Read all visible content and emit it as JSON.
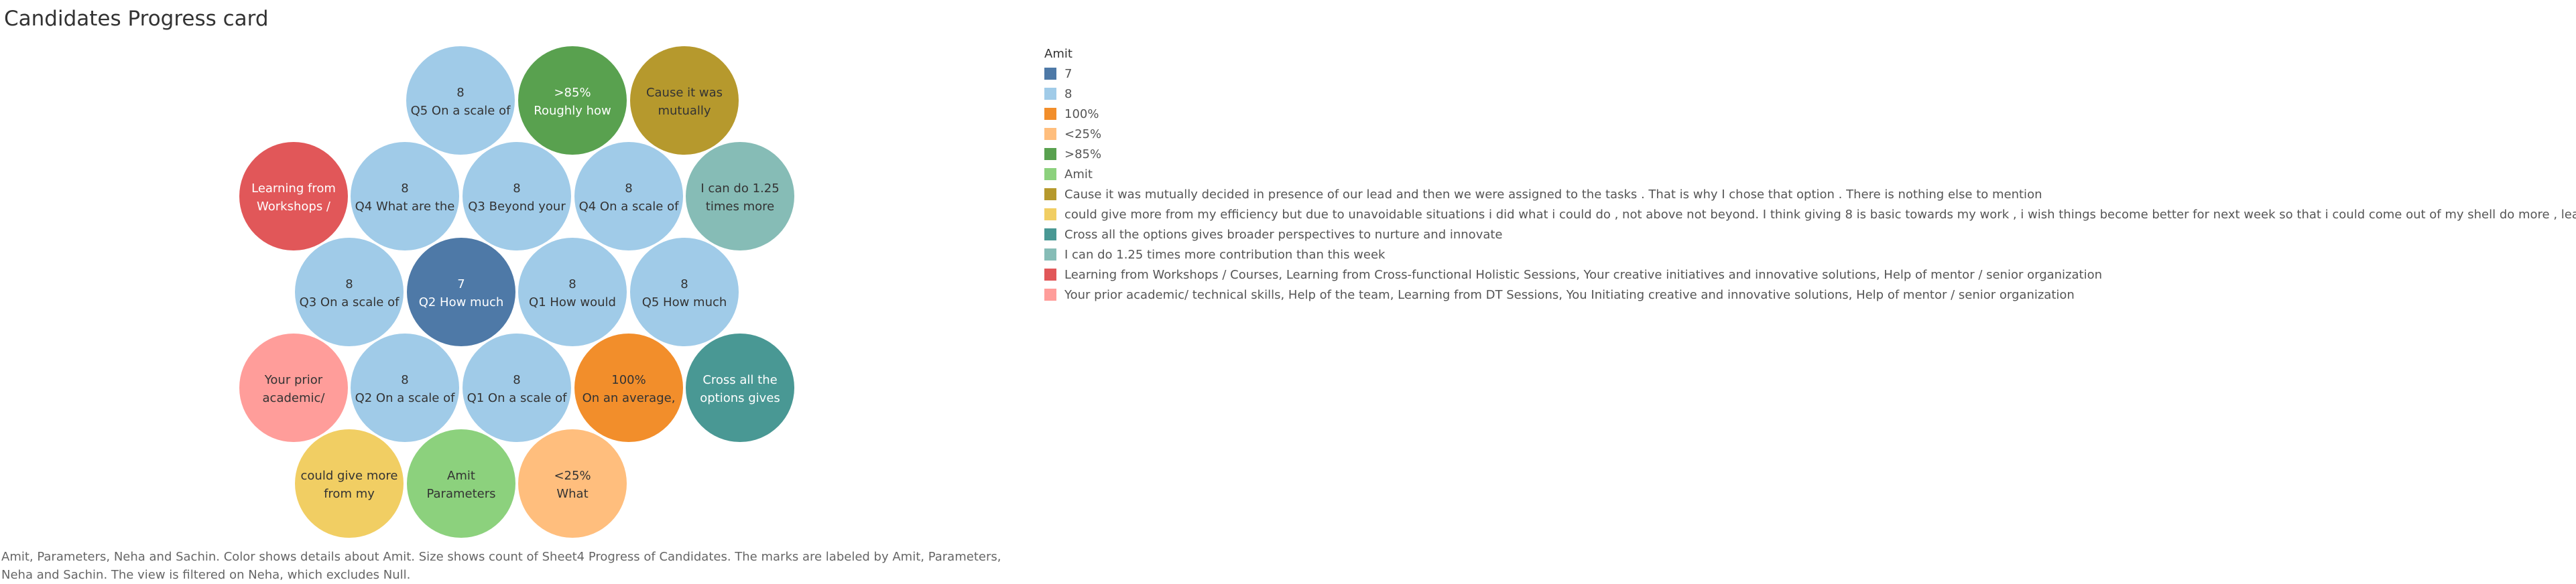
{
  "title": "Candidates Progress card",
  "caption": "Amit, Parameters, Neha and Sachin.  Color shows details about Amit.  Size shows count of Sheet4 Progress of Candidates.  The marks are labeled by Amit, Parameters, Neha and Sachin. The view is filtered on Neha, which excludes Null.",
  "chart_data": {
    "type": "packed-bubble",
    "color_field": "Amit",
    "size_field": "count of Sheet4 Progress of Candidates",
    "legend": {
      "title": "Amit",
      "items": [
        {
          "label": "7",
          "color": "#4e79a7"
        },
        {
          "label": "8",
          "color": "#a0cbe8"
        },
        {
          "label": "100%",
          "color": "#f28e2b"
        },
        {
          "label": "<25%",
          "color": "#ffbe7d"
        },
        {
          "label": ">85%",
          "color": "#59a14f"
        },
        {
          "label": "Amit",
          "color": "#8cd17d"
        },
        {
          "label": "Cause it was mutually decided in presence of our lead and then we were assigned to the tasks . That is why I chose that option . There is nothing else to mention",
          "color": "#b6992d"
        },
        {
          "label": "could give more from my efficiency but due to unavoidable situations i did what i could do , not above not beyond. I think giving 8 is basic towards my work , i wish things become better for next week so that i  could come out of my shell do more , learn more effectively.",
          "color": "#f1ce63"
        },
        {
          "label": "Cross all the options gives broader perspectives to nurture and innovate",
          "color": "#499894"
        },
        {
          "label": "I can do 1.25 times more contribution than this week",
          "color": "#86bcb6"
        },
        {
          "label": "Learning from Workshops / Courses, Learning from Cross-functional Holistic Sessions, Your creative initiatives and innovative solutions, Help of mentor / senior organization",
          "color": "#e15759"
        },
        {
          "label": "Your prior academic/ technical skills, Help of the team, Learning from DT Sessions, You Initiating creative and innovative solutions, Help of mentor / senior organization",
          "color": "#ff9d9a"
        }
      ]
    },
    "bubbles": [
      {
        "lines": [
          "8",
          "Q5 On a scale of"
        ],
        "color": "#a0cbe8",
        "text": "#333"
      },
      {
        "lines": [
          ">85%",
          "Roughly how"
        ],
        "color": "#59a14f",
        "text": "#ffffff"
      },
      {
        "lines": [
          "Cause it was",
          "mutually"
        ],
        "color": "#b6992d",
        "text": "#333"
      },
      {
        "lines": [
          "Learning from",
          "Workshops /"
        ],
        "color": "#e15759",
        "text": "#ffffff"
      },
      {
        "lines": [
          "8",
          "Q4 What are the"
        ],
        "color": "#a0cbe8",
        "text": "#333"
      },
      {
        "lines": [
          "8",
          "Q3 Beyond your"
        ],
        "color": "#a0cbe8",
        "text": "#333"
      },
      {
        "lines": [
          "8",
          "Q4 On a scale of"
        ],
        "color": "#a0cbe8",
        "text": "#333"
      },
      {
        "lines": [
          "I can do 1.25",
          "times more"
        ],
        "color": "#86bcb6",
        "text": "#333"
      },
      {
        "lines": [
          "8",
          "Q3 On a scale of"
        ],
        "color": "#a0cbe8",
        "text": "#333"
      },
      {
        "lines": [
          "7",
          "Q2 How much"
        ],
        "color": "#4e79a7",
        "text": "#ffffff"
      },
      {
        "lines": [
          "8",
          "Q1 How would"
        ],
        "color": "#a0cbe8",
        "text": "#333"
      },
      {
        "lines": [
          "8",
          "Q5 How much"
        ],
        "color": "#a0cbe8",
        "text": "#333"
      },
      {
        "lines": [
          "Your prior",
          "academic/"
        ],
        "color": "#ff9d9a",
        "text": "#333"
      },
      {
        "lines": [
          "8",
          "Q2 On a scale of"
        ],
        "color": "#a0cbe8",
        "text": "#333"
      },
      {
        "lines": [
          "8",
          "Q1 On a scale of"
        ],
        "color": "#a0cbe8",
        "text": "#333"
      },
      {
        "lines": [
          "100%",
          "On an average,"
        ],
        "color": "#f28e2b",
        "text": "#333"
      },
      {
        "lines": [
          "Cross all the",
          "options gives"
        ],
        "color": "#499894",
        "text": "#ffffff"
      },
      {
        "lines": [
          "could give more",
          "from my"
        ],
        "color": "#f1ce63",
        "text": "#333"
      },
      {
        "lines": [
          "Amit",
          "Parameters"
        ],
        "color": "#8cd17d",
        "text": "#333"
      },
      {
        "lines": [
          "<25%",
          "What"
        ],
        "color": "#ffbe7d",
        "text": "#333"
      }
    ]
  }
}
